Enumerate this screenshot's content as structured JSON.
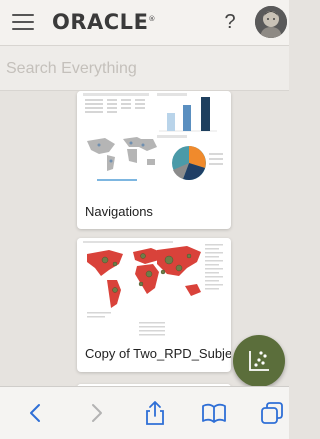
{
  "header": {
    "logo_text": "ORACLE",
    "logo_reg": "®",
    "help_label": "?",
    "menu_icon": "hamburger-icon",
    "avatar_icon": "user-avatar"
  },
  "search": {
    "placeholder": "Search Everything"
  },
  "cards": [
    {
      "name": "Navigations",
      "thumb": "dashboard-thumbnail"
    },
    {
      "name": "Copy of Two_RPD_Subje...",
      "thumb": "world-map-thumbnail"
    },
    {
      "name": "",
      "thumb": "table-thumbnail"
    }
  ],
  "fab": {
    "icon": "scatter-plot-icon"
  },
  "toolbar": {
    "items": [
      "back-icon",
      "forward-icon",
      "share-icon",
      "bookmarks-icon",
      "tabs-icon"
    ]
  },
  "colors": {
    "accent": "#5b6e3b",
    "map_red": "#d9423a",
    "header_bg": "#f4f2ef",
    "content_bg": "#e6e3df",
    "toolbar_icon": "#2f6fd6"
  }
}
